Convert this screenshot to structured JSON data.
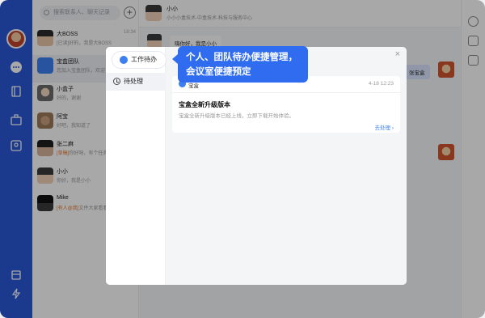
{
  "search": {
    "placeholder": "搜索联系人、聊天记录"
  },
  "conversations": [
    {
      "name": "大BOSS",
      "preview": "[已读]好的，我是大BOSS",
      "time": "18:34"
    },
    {
      "name": "宝盒团队",
      "preview": "您加入宝盒团队，欢迎",
      "time": ""
    },
    {
      "name": "小盒子",
      "preview": "好的，谢谢",
      "time": ""
    },
    {
      "name": "阿宝",
      "preview": "好吧，我知道了",
      "time": ""
    },
    {
      "name": "张二麻",
      "tag": "[草稿]",
      "preview": "你好呀，有个任务",
      "time": ""
    },
    {
      "name": "小小",
      "preview": "你好，我是小小",
      "time": ""
    },
    {
      "name": "Mike",
      "tag": "[有人@我]",
      "preview": "文件大家看看",
      "time": ""
    }
  ],
  "chat": {
    "title": "小小",
    "subtitle": "小小小盒技术-中盒技术-科技与服务中心",
    "msg_left": "嗨你好，我是小小",
    "msg_right": "张宝盒"
  },
  "dialog": {
    "tab_label": "待处理",
    "pill_label": "工作待办",
    "tooltip_line1": "个人、团队待办便捷管理，",
    "tooltip_line2": "会议室便捷预定",
    "close_glyph": "×",
    "card": {
      "source": "宝盒",
      "date": "4-18 12:23",
      "title": "宝盒全新升级版本",
      "desc": "宝盒全新升级版本已经上线，立即下载开始体验。",
      "action": "去处理 ›"
    }
  },
  "colors": {
    "rail": "#2a57d6",
    "accent": "#2f6cf0"
  }
}
